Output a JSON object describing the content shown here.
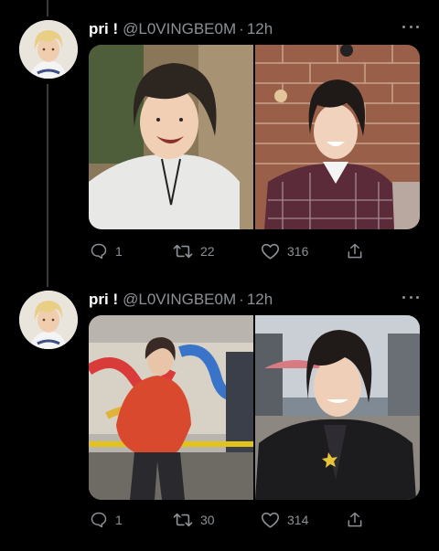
{
  "tweets": [
    {
      "display_name": "pri !",
      "handle": "@L0VINGBE0M",
      "separator": "·",
      "time": "12h",
      "avatar_icon": "avatar-blonde-portrait",
      "media": [
        {
          "icon": "photo-person-white-jacket-laughing"
        },
        {
          "icon": "photo-person-plaid-shirt-brick-wall"
        }
      ],
      "actions": {
        "reply_count": "1",
        "retweet_count": "22",
        "like_count": "316"
      }
    },
    {
      "display_name": "pri !",
      "handle": "@L0VINGBE0M",
      "separator": "·",
      "time": "12h",
      "avatar_icon": "avatar-blonde-portrait",
      "media": [
        {
          "icon": "photo-person-red-sweater-graffiti"
        },
        {
          "icon": "photo-person-black-jacket-outdoors"
        }
      ],
      "actions": {
        "reply_count": "1",
        "retweet_count": "30",
        "like_count": "314"
      }
    }
  ],
  "colors": {
    "background": "#000000",
    "text_primary": "#ffffff",
    "text_secondary": "#8b9196",
    "thread_line": "#3a3a3a"
  }
}
